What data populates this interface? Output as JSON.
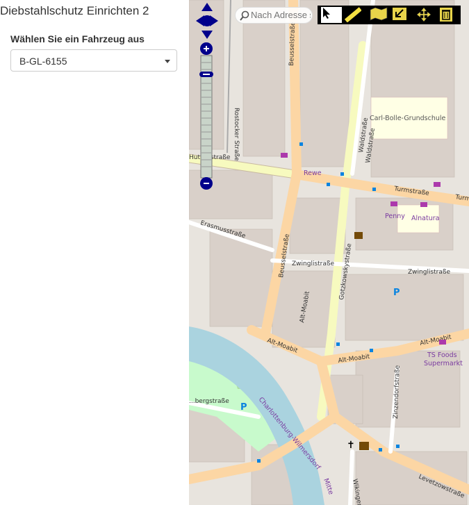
{
  "panel": {
    "title": "Diebstahlschutz Einrichten 2",
    "vehicle_label": "Wählen Sie ein Fahrzeug aus",
    "vehicle_selected": "B-GL-6155"
  },
  "map": {
    "search_placeholder": "Nach Adresse suchen",
    "streets": {
      "beusselstrasse_top": "Beusselstraße",
      "beusselstrasse_mid": "Beusselstraße",
      "rostocker": "Rostocker Straße",
      "huttenstrasse": "Huttenstraße",
      "waldstrasse_1": "Waldstraße",
      "waldstrasse_2": "Waldstraße",
      "turmstrasse_1": "Turmstraße",
      "turmstrasse_2": "Turm",
      "erasmusstrasse": "Erasmusstraße",
      "zwinglistrasse_1": "Zwinglistraße",
      "zwinglistrasse_2": "Zwinglistraße",
      "gotzkowskystrasse": "Gotzkowskystraße",
      "alt_moabit_1": "Alt-Moabit",
      "alt_moabit_2": "Alt-Moabit",
      "alt_moabit_3": "Alt-Moabit",
      "alt_moabit_side": "Alt-Moabit",
      "zinzendorfstrasse": "Zinzendorfstraße",
      "levetzowstrasse": "Levetzowstraße",
      "wikinger": "Wikinger",
      "bergstrasse": "...bergstraße",
      "charlottenburg_wilmersdorf": "Charlottenburg-Wilmersdorf",
      "mitte": "Mitte"
    },
    "pois": {
      "school": "Carl-Bolle-Grundschule",
      "rewe": "Rewe",
      "penny": "Penny",
      "alnatura": "Alnatura",
      "ts_foods": "TS Foods",
      "supermarkt": "Supermarkt",
      "parking": "P"
    },
    "colors": {
      "background": "#f2efe9",
      "building": "#d9d0c9",
      "primary_road": "#fcd6a4",
      "secondary_road": "#f7fabf",
      "water": "#aad3df",
      "park": "#c8facc",
      "poi_text": "#7a3ba0",
      "bus_stop": "#0a84e0"
    }
  },
  "toolbar": {
    "tools": [
      "select-arrow",
      "measure-ruler",
      "map-area",
      "draw-corner",
      "move-arrows",
      "delete-trash"
    ]
  }
}
